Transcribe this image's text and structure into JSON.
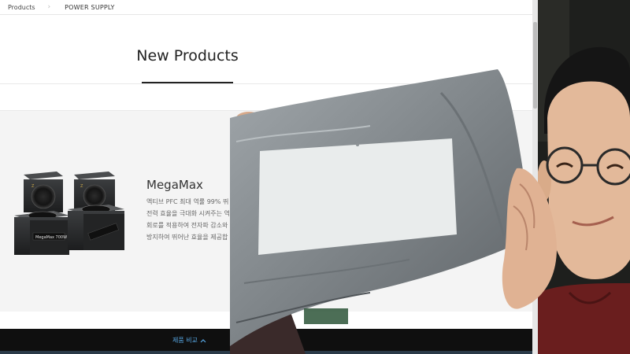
{
  "breadcrumb": {
    "home": "Products",
    "separator": "›",
    "current": "POWER SUPPLY"
  },
  "section": {
    "title": "New Products"
  },
  "product": {
    "name": "MegaMax",
    "image_label": "MegaMax 700W",
    "description_lines": [
      "액티브 PFC 최대 역률 99% 뛰",
      "전력 효율을 극대화 시켜주는 역",
      "회로를 적용하여 전자파 감소와",
      "방지하여 뛰어난 효율을 제공합"
    ]
  },
  "compare": {
    "label": "제품 비교",
    "icon": "chevron-up-icon"
  },
  "colors": {
    "accent": "#58a9e6",
    "panel": "#f4f4f4",
    "bar": "#0f0f0f",
    "package": "#8c9296"
  }
}
